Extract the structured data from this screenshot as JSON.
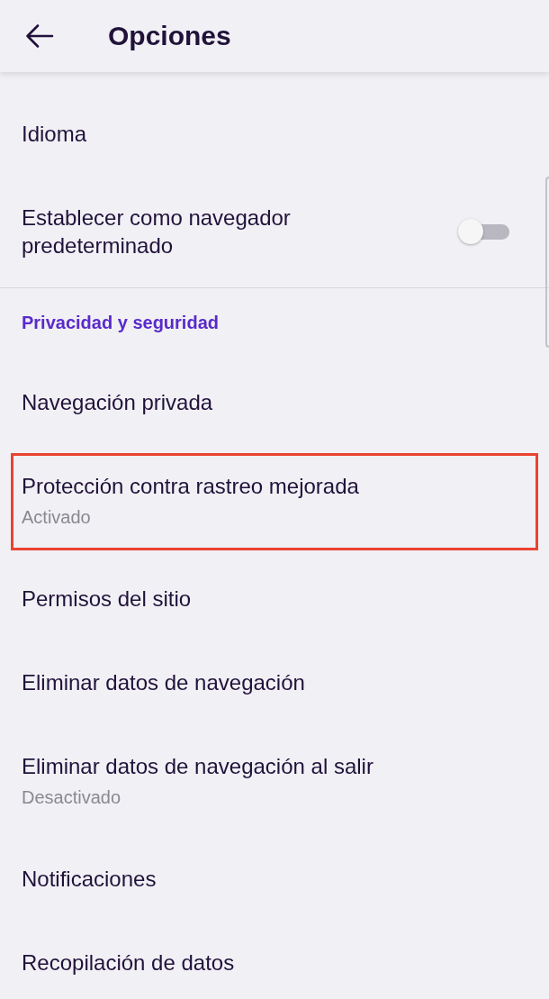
{
  "header": {
    "title": "Opciones"
  },
  "sections": [
    {
      "items": [
        {
          "kind": "link",
          "label": "Idioma",
          "highlighted": false
        },
        {
          "kind": "switch",
          "label": "Establecer como navegador predeterminado",
          "on": false,
          "highlighted": false
        }
      ]
    },
    {
      "title": "Privacidad y seguridad",
      "items": [
        {
          "kind": "link",
          "label": "Navegación privada",
          "highlighted": false
        },
        {
          "kind": "link",
          "label": "Protección contra rastreo mejorada",
          "summary": "Activado",
          "highlighted": true
        },
        {
          "kind": "link",
          "label": "Permisos del sitio",
          "highlighted": false
        },
        {
          "kind": "link",
          "label": "Eliminar datos de navegación",
          "highlighted": false
        },
        {
          "kind": "link",
          "label": "Eliminar datos de navegación al salir",
          "summary": "Desactivado",
          "highlighted": false
        },
        {
          "kind": "link",
          "label": "Notificaciones",
          "highlighted": false
        },
        {
          "kind": "link",
          "label": "Recopilación de datos",
          "highlighted": false
        }
      ]
    }
  ]
}
